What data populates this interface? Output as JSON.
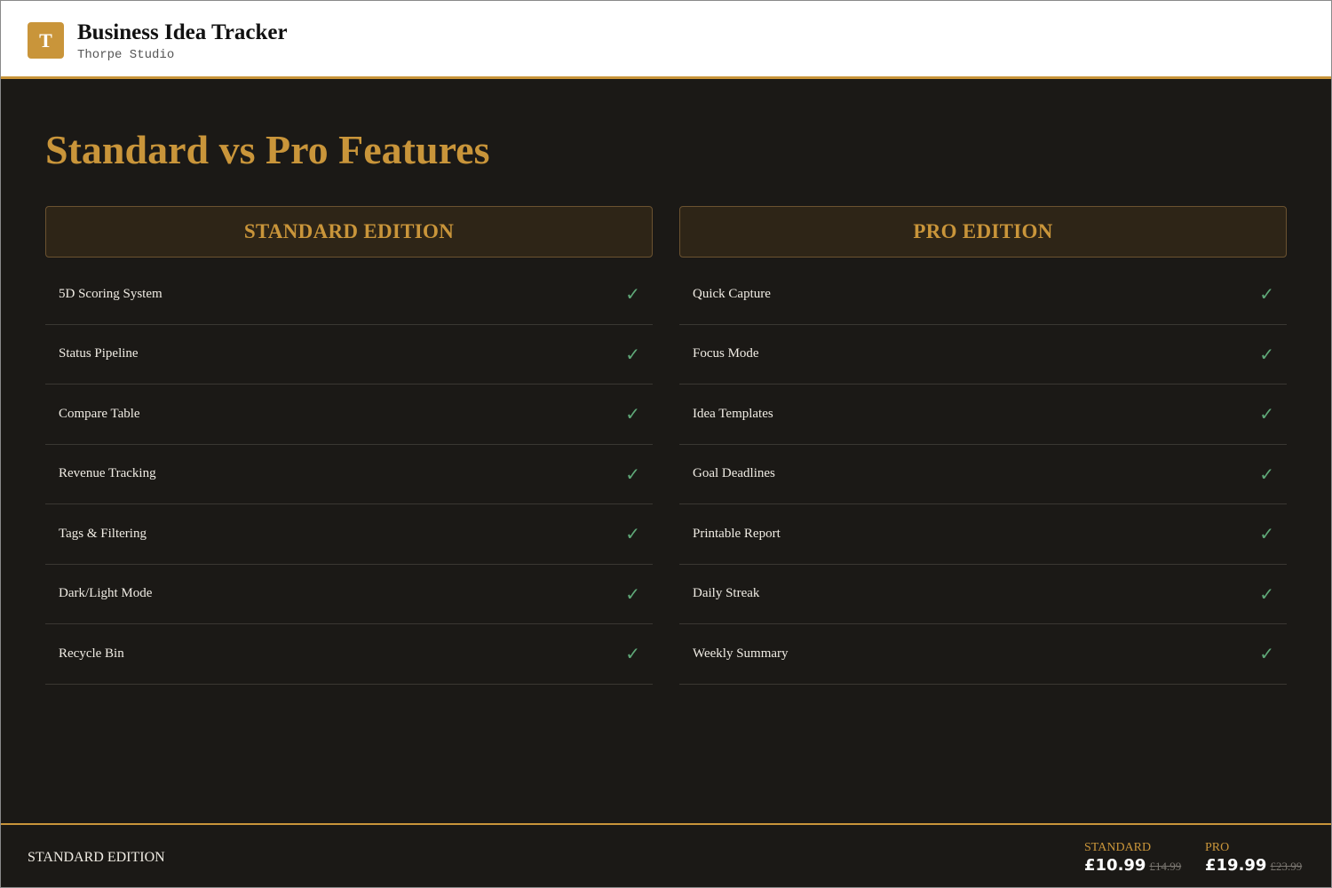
{
  "app": {
    "logo_letter": "T",
    "title": "Business Idea Tracker",
    "subtitle": "Thorpe Studio"
  },
  "page_title": "Standard vs Pro Features",
  "columns": {
    "standard": {
      "heading": "STANDARD EDITION",
      "features": [
        {
          "label": "5D Scoring System",
          "mark": "✓"
        },
        {
          "label": "Status Pipeline",
          "mark": "✓"
        },
        {
          "label": "Compare Table",
          "mark": "✓"
        },
        {
          "label": "Revenue Tracking",
          "mark": "✓"
        },
        {
          "label": "Tags & Filtering",
          "mark": "✓"
        },
        {
          "label": "Dark/Light Mode",
          "mark": "✓"
        },
        {
          "label": "Recycle Bin",
          "mark": "✓"
        }
      ]
    },
    "pro": {
      "heading": "PRO EDITION",
      "features": [
        {
          "label": "Quick Capture",
          "mark": "✓"
        },
        {
          "label": "Focus Mode",
          "mark": "✓"
        },
        {
          "label": "Idea Templates",
          "mark": "✓"
        },
        {
          "label": "Goal Deadlines",
          "mark": "✓"
        },
        {
          "label": "Printable Report",
          "mark": "✓"
        },
        {
          "label": "Daily Streak",
          "mark": "✓"
        },
        {
          "label": "Weekly Summary",
          "mark": "✓"
        }
      ]
    }
  },
  "footer": {
    "edition": "STANDARD EDITION",
    "standard": {
      "label": "STANDARD",
      "price": "£10.99",
      "was": "£14.99"
    },
    "pro": {
      "label": "PRO",
      "price": "£19.99",
      "was": "£23.99"
    }
  },
  "colors": {
    "accent": "#c9953a",
    "background": "#1b1916",
    "check": "#5fa878"
  }
}
